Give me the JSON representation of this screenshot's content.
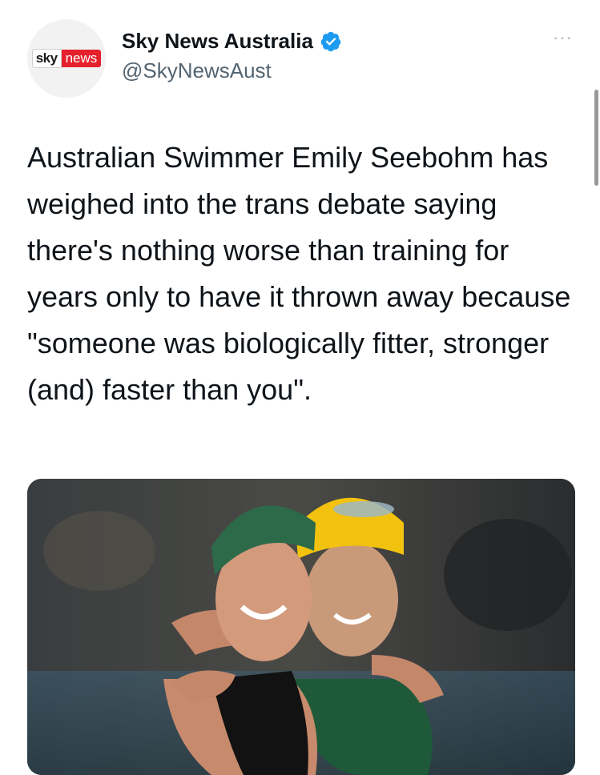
{
  "account": {
    "name": "Sky News Australia",
    "handle": "@SkyNewsAust",
    "verified": true,
    "avatar_logo": {
      "part1": "sky",
      "part2": "news"
    }
  },
  "tweet": {
    "text": "Australian Swimmer Emily Seebohm has weighed into the trans debate saying there's nothing worse than training for years only to have it thrown away because \"someone was biologically fitter, stronger (and) faster than you\"."
  },
  "more_label": "···",
  "colors": {
    "brand_red": "#e5202c",
    "verified_blue": "#1d9bf0",
    "handle_gray": "#536471"
  }
}
